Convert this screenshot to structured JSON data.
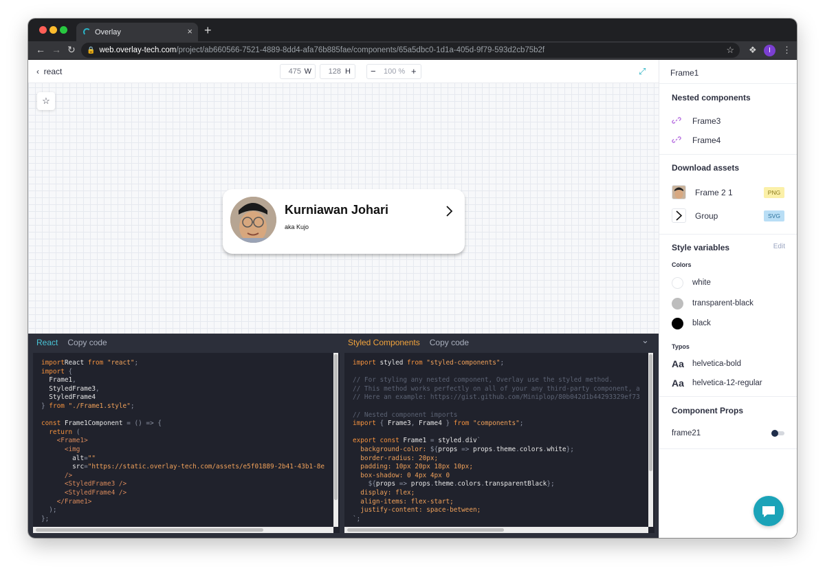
{
  "browser": {
    "tab_title": "Overlay",
    "tab_close": "×",
    "new_tab": "+",
    "url_host": "web.overlay-tech.com",
    "url_path": "/project/ab660566-7521-4889-8dd4-afa76b885fae/components/65a5dbc0-1d1a-405d-9f79-593d2cb75b2f",
    "profile_initial": "I",
    "colors": {
      "tab_strip": "#1f2023",
      "toolbar": "#35363a",
      "accent": "#2ab3c6",
      "profile": "#7b3fd1"
    }
  },
  "topbar": {
    "back_label": "react",
    "width_value": "475",
    "width_unit": "W",
    "height_value": "128",
    "height_unit": "H",
    "zoom_minus": "−",
    "zoom_value": "100 %",
    "zoom_plus": "+"
  },
  "card": {
    "name": "Kurniawan Johari",
    "subtitle": "aka Kujo"
  },
  "code_left": {
    "tab_label": "React",
    "copy_label": "Copy code",
    "lines": [
      [
        [
          "kw",
          "import"
        ],
        [
          "",
          "React"
        ],
        [
          "kw",
          " from "
        ],
        [
          "str",
          "\"react\""
        ],
        [
          "op",
          ";"
        ]
      ],
      [
        [
          "kw",
          "import"
        ],
        [
          "op",
          " {"
        ]
      ],
      [
        [
          "",
          "  Frame1"
        ],
        [
          "op",
          ","
        ]
      ],
      [
        [
          "",
          "  StyledFrame3"
        ],
        [
          "op",
          ","
        ]
      ],
      [
        [
          "",
          "  StyledFrame4"
        ]
      ],
      [
        [
          "op",
          "} "
        ],
        [
          "kw",
          "from "
        ],
        [
          "str",
          "\"./Frame1.style\""
        ],
        [
          "op",
          ";"
        ]
      ],
      [
        [
          "",
          ""
        ]
      ],
      [
        [
          "kw",
          "const "
        ],
        [
          "",
          "Frame1Component "
        ],
        [
          "op",
          "= () => {"
        ]
      ],
      [
        [
          "kw",
          "  return "
        ],
        [
          "op",
          "("
        ]
      ],
      [
        [
          "tg",
          "    <Frame1>"
        ]
      ],
      [
        [
          "tg",
          "      <img"
        ]
      ],
      [
        [
          "",
          "        alt"
        ],
        [
          "op",
          "="
        ],
        [
          "str",
          "\"\""
        ]
      ],
      [
        [
          "",
          "        src"
        ],
        [
          "op",
          "="
        ],
        [
          "str",
          "\"https://static.overlay-tech.com/assets/e5f01889-2b41-43b1-8e"
        ]
      ],
      [
        [
          "tg",
          "      />"
        ]
      ],
      [
        [
          "tg",
          "      <StyledFrame3 />"
        ]
      ],
      [
        [
          "tg",
          "      <StyledFrame4 />"
        ]
      ],
      [
        [
          "tg",
          "    </Frame1>"
        ]
      ],
      [
        [
          "op",
          "  );"
        ]
      ],
      [
        [
          "op",
          "};"
        ]
      ]
    ]
  },
  "code_right": {
    "tab_label": "Styled Components",
    "copy_label": "Copy code",
    "collapse_icon": "⌄",
    "lines": [
      [
        [
          "kw",
          "import"
        ],
        [
          "",
          " styled "
        ],
        [
          "kw",
          "from "
        ],
        [
          "str",
          "\"styled-components\""
        ],
        [
          "op",
          ";"
        ]
      ],
      [
        [
          "",
          ""
        ]
      ],
      [
        [
          "cm",
          "// For styling any nested component, Overlay use the styled method."
        ]
      ],
      [
        [
          "cm",
          "// This method works perfectly on all of your any third-party component, a"
        ]
      ],
      [
        [
          "cm",
          "// Here an example: https://gist.github.com/Miniplop/80b042d1b44293329ef73"
        ]
      ],
      [
        [
          "",
          ""
        ]
      ],
      [
        [
          "cm",
          "// Nested component imports"
        ]
      ],
      [
        [
          "kw",
          "import"
        ],
        [
          "op",
          " { "
        ],
        [
          "",
          "Frame3"
        ],
        [
          "op",
          ", "
        ],
        [
          "",
          "Frame4"
        ],
        [
          "op",
          " } "
        ],
        [
          "kw",
          "from "
        ],
        [
          "str",
          "\"components\""
        ],
        [
          "op",
          ";"
        ]
      ],
      [
        [
          "",
          ""
        ]
      ],
      [
        [
          "kw",
          "export const "
        ],
        [
          "",
          "Frame1 "
        ],
        [
          "op",
          "= "
        ],
        [
          "",
          "styled"
        ],
        [
          "op",
          "."
        ],
        [
          "",
          "div"
        ],
        [
          "op",
          "`"
        ]
      ],
      [
        [
          "str",
          "  background-color: "
        ],
        [
          "op",
          "${"
        ],
        [
          "",
          "props "
        ],
        [
          "op",
          "=> "
        ],
        [
          "",
          "props"
        ],
        [
          "op",
          "."
        ],
        [
          "",
          "theme"
        ],
        [
          "op",
          "."
        ],
        [
          "",
          "colors"
        ],
        [
          "op",
          "."
        ],
        [
          "",
          "white"
        ],
        [
          "op",
          "};"
        ]
      ],
      [
        [
          "str",
          "  border-radius: 20px;"
        ]
      ],
      [
        [
          "str",
          "  padding: 10px 20px 18px 10px;"
        ]
      ],
      [
        [
          "str",
          "  box-shadow: 0 4px 4px 0"
        ]
      ],
      [
        [
          "op",
          "    ${"
        ],
        [
          "",
          "props "
        ],
        [
          "op",
          "=> "
        ],
        [
          "",
          "props"
        ],
        [
          "op",
          "."
        ],
        [
          "",
          "theme"
        ],
        [
          "op",
          "."
        ],
        [
          "",
          "colors"
        ],
        [
          "op",
          "."
        ],
        [
          "",
          "transparentBlack"
        ],
        [
          "op",
          "};"
        ]
      ],
      [
        [
          "str",
          "  display: flex;"
        ]
      ],
      [
        [
          "str",
          "  align-items: flex-start;"
        ]
      ],
      [
        [
          "str",
          "  justify-content: space-between;"
        ]
      ],
      [
        [
          "op",
          "`;"
        ]
      ]
    ]
  },
  "sidebar": {
    "title": "Frame1",
    "nested": {
      "heading": "Nested components",
      "items": [
        "Frame3",
        "Frame4"
      ]
    },
    "assets": {
      "heading": "Download assets",
      "items": [
        {
          "label": "Frame 2 1",
          "badge": "PNG"
        },
        {
          "label": "Group",
          "badge": "SVG"
        }
      ]
    },
    "styles": {
      "heading": "Style variables",
      "edit_label": "Edit",
      "colors_heading": "Colors",
      "colors": [
        {
          "label": "white",
          "hex": "#ffffff"
        },
        {
          "label": "transparent-black",
          "hex": "#bdbdbd"
        },
        {
          "label": "black",
          "hex": "#000000"
        }
      ],
      "typos_heading": "Typos",
      "typo_glyph": "Aa",
      "typos": [
        "helvetica-bold",
        "helvetica-12-regular"
      ]
    },
    "props": {
      "heading": "Component Props",
      "items": [
        {
          "label": "frame21",
          "enabled": false
        }
      ]
    }
  }
}
